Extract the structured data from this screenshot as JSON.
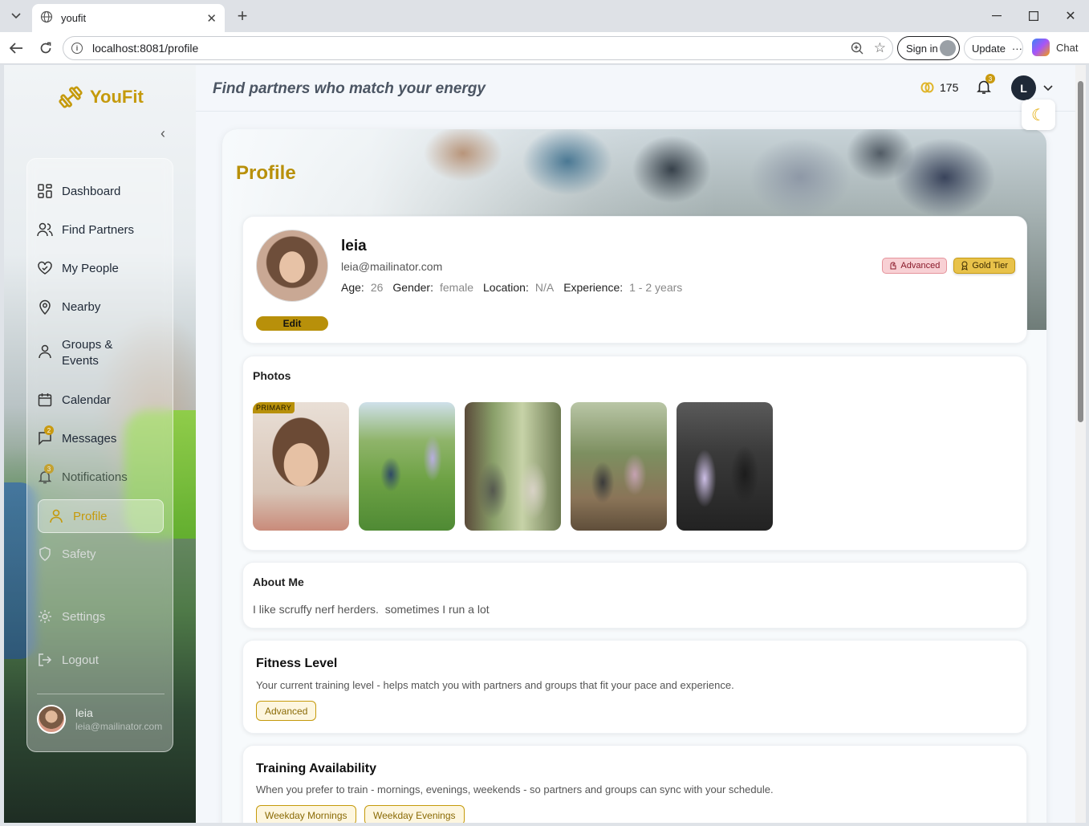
{
  "browser": {
    "tab_title": "youfit",
    "url": "localhost:8081/profile",
    "signin_label": "Sign in",
    "update_label": "Update",
    "chat_label": "Chat"
  },
  "app": {
    "logo_text": "YouFit",
    "tagline": "Find partners who match your energy",
    "coins": "175",
    "notifications_count": "3",
    "avatar_initial": "L",
    "accent_color": "#b8900a"
  },
  "sidebar": {
    "items": [
      {
        "label": "Dashboard",
        "icon": "grid-icon"
      },
      {
        "label": "Find Partners",
        "icon": "users-icon"
      },
      {
        "label": "My People",
        "icon": "heart-handshake-icon"
      },
      {
        "label": "Nearby",
        "icon": "map-pin-icon"
      },
      {
        "label": "Groups & Events",
        "icon": "group-icon"
      },
      {
        "label": "Calendar",
        "icon": "calendar-icon"
      },
      {
        "label": "Messages",
        "icon": "message-icon",
        "badge": "2"
      },
      {
        "label": "Notifications",
        "icon": "bell-icon",
        "badge": "3"
      },
      {
        "label": "Profile",
        "icon": "user-icon",
        "active": true
      },
      {
        "label": "Safety",
        "icon": "shield-icon"
      },
      {
        "label": "Settings",
        "icon": "gear-icon"
      },
      {
        "label": "Logout",
        "icon": "logout-icon"
      }
    ],
    "user": {
      "name": "leia",
      "email": "leia@mailinator.com"
    }
  },
  "profile": {
    "page_title": "Profile",
    "name": "leia",
    "email": "leia@mailinator.com",
    "edit_label": "Edit",
    "age_label": "Age:",
    "age": "26",
    "gender_label": "Gender:",
    "gender": "female",
    "location_label": "Location:",
    "location": "N/A",
    "experience_label": "Experience:",
    "experience": "1 - 2 years",
    "badges": {
      "level": "Advanced",
      "tier": "Gold Tier"
    }
  },
  "photos": {
    "title": "Photos",
    "primary_tag": "PRIMARY",
    "count": 5
  },
  "about": {
    "title": "About Me",
    "text": "I like scruffy nerf herders.  sometimes I run a lot"
  },
  "fitness": {
    "title": "Fitness Level",
    "description": "Your current training level - helps match you with partners and groups that fit your pace and experience.",
    "level": "Advanced"
  },
  "availability": {
    "title": "Training Availability",
    "description": "When you prefer to train - mornings, evenings, weekends - so partners and groups can sync with your schedule.",
    "slots": [
      "Weekday Mornings",
      "Weekday Evenings"
    ]
  }
}
